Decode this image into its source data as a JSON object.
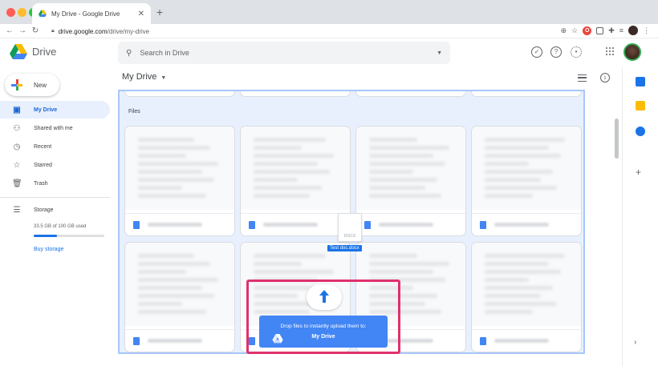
{
  "browser": {
    "tab_title": "My Drive - Google Drive",
    "url_host": "drive.google.com",
    "url_path": "/drive/my-drive"
  },
  "header": {
    "app_name": "Drive",
    "search_placeholder": "Search in Drive"
  },
  "sidebar": {
    "new_label": "New",
    "items": [
      {
        "label": "My Drive",
        "icon": "my-drive-icon"
      },
      {
        "label": "Shared with me",
        "icon": "people-icon"
      },
      {
        "label": "Recent",
        "icon": "clock-icon"
      },
      {
        "label": "Starred",
        "icon": "star-icon"
      },
      {
        "label": "Trash",
        "icon": "trash-icon"
      },
      {
        "label": "Storage",
        "icon": "storage-icon"
      }
    ],
    "storage_used": "33.5 GB of 100 GB used",
    "storage_fraction": 0.335,
    "buy_storage": "Buy storage"
  },
  "main": {
    "title": "My Drive",
    "section_label": "Files",
    "dragged_ext": "DOCX",
    "dragged_name": "Test doc.docx",
    "drop_message": "Drop files to instantly upload them to:",
    "drop_target": "My Drive"
  },
  "colors": {
    "accent": "#1a73e8",
    "highlight": "#e0316e",
    "drop_zone": "#e8f0fe"
  }
}
